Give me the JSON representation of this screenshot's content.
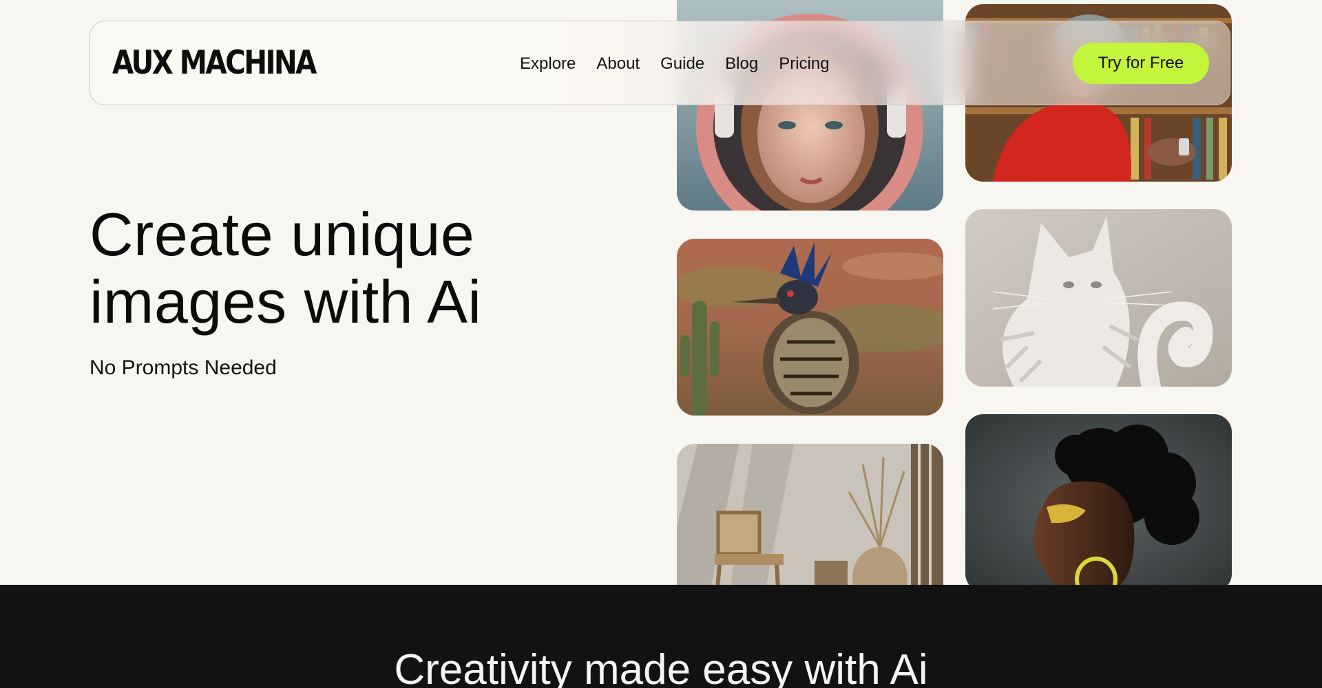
{
  "brand": {
    "logo_text": "AUX MACHINA"
  },
  "nav": {
    "items": [
      {
        "label": "Explore"
      },
      {
        "label": "About"
      },
      {
        "label": "Guide"
      },
      {
        "label": "Blog"
      },
      {
        "label": "Pricing"
      }
    ],
    "cta_label": "Try for Free"
  },
  "hero": {
    "title_line1": "Create unique",
    "title_line2": "images with Ai",
    "subtitle": "No Prompts Needed"
  },
  "section": {
    "title": "Creativity made easy with Ai"
  },
  "colors": {
    "page_bg": "#f8f6f0",
    "cta_bg": "#c3f53c",
    "dark_bg": "#121212",
    "text": "#111111"
  }
}
